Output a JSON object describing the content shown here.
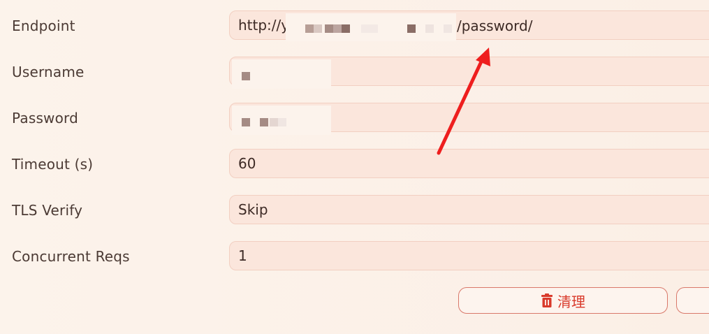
{
  "form": {
    "fields": [
      {
        "label": "Endpoint",
        "value_prefix": "http://y",
        "value_suffix": "/password/"
      },
      {
        "label": "Username",
        "value": ""
      },
      {
        "label": "Password",
        "value": ""
      },
      {
        "label": "Timeout (s)",
        "value": "60"
      },
      {
        "label": "TLS Verify",
        "value": "Skip"
      },
      {
        "label": "Concurrent Reqs",
        "value": "1"
      }
    ]
  },
  "actions": {
    "clear_label": "清理",
    "clear_icon": "trash-icon",
    "second_label": ""
  },
  "annotation": {
    "arrow_color": "#ee1e1e"
  },
  "colors": {
    "background": "#fbf1e8",
    "field_background": "#fbe6dc",
    "field_border": "#f2cfc1",
    "accent_red": "#d93a2b",
    "label_text": "#4b3a34"
  }
}
